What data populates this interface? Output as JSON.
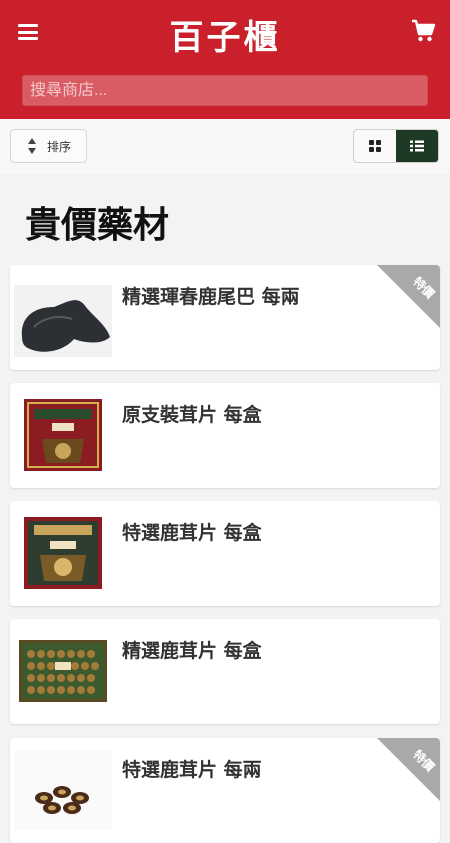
{
  "header": {
    "logo_text": "百子櫃",
    "search_placeholder": "搜尋商店..."
  },
  "toolbar": {
    "sort_label": "排序"
  },
  "page": {
    "title": "貴價藥材"
  },
  "colors": {
    "brand": "#c9202b",
    "active_view": "#1f3a24",
    "ribbon": "#a9a9a9"
  },
  "products": [
    {
      "name": "精選琿春鹿尾巴 每兩",
      "badge": "特價"
    },
    {
      "name": "原支裝茸片 每盒",
      "badge": ""
    },
    {
      "name": "特選鹿茸片 每盒",
      "badge": ""
    },
    {
      "name": "精選鹿茸片 每盒",
      "badge": ""
    },
    {
      "name": "特選鹿茸片 每兩",
      "badge": "特價"
    }
  ]
}
